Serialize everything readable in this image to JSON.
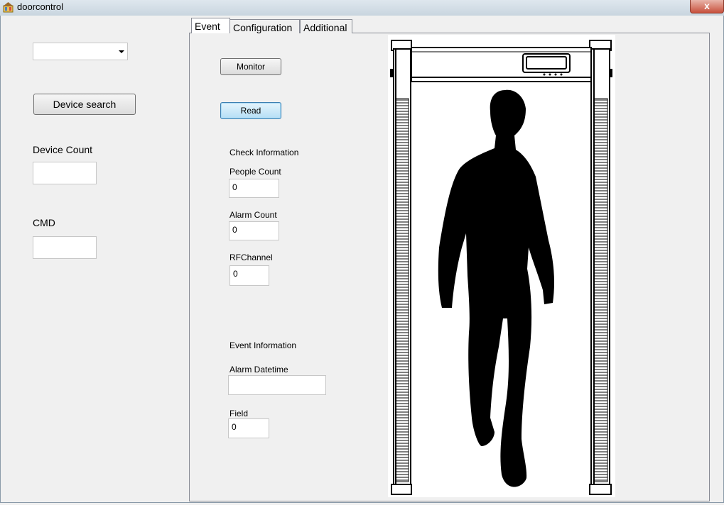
{
  "window": {
    "title": "doorcontrol",
    "close_glyph": "x"
  },
  "left": {
    "device_select_value": "",
    "device_search_label": "Device search",
    "device_count_label": "Device Count",
    "device_count_value": "",
    "cmd_label": "CMD",
    "cmd_value": ""
  },
  "tabs": [
    {
      "label": "Event",
      "active": true
    },
    {
      "label": "Configuration",
      "active": false
    },
    {
      "label": "Additional",
      "active": false
    }
  ],
  "event": {
    "monitor_label": "Monitor",
    "read_label": "Read",
    "check_info_label": "Check Information",
    "people_count_label": "People Count",
    "people_count_value": "0",
    "alarm_count_label": "Alarm Count",
    "alarm_count_value": "0",
    "rfchannel_label": "RFChannel",
    "rfchannel_value": "0",
    "event_info_label": "Event Information",
    "alarm_datetime_label": "Alarm Datetime",
    "alarm_datetime_value": "",
    "field_label": "Field",
    "field_value": "0"
  },
  "illustration": {
    "name": "walk-through metal detector with person silhouette"
  },
  "colors": {
    "accent": "#3c7fb1",
    "silhouette": "#000000"
  }
}
